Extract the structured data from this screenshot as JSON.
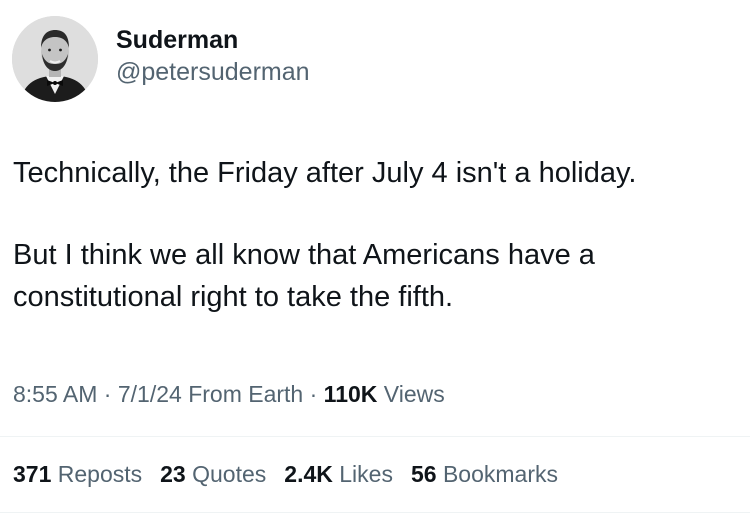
{
  "author": {
    "display_name": "Suderman",
    "handle": "@petersuderman",
    "avatar_icon": "profile-photo"
  },
  "tweet": {
    "paragraphs": [
      "Technically, the Friday after July 4 isn't a holiday.",
      "But I think we all know that Americans have a constitutional right to take the fifth."
    ]
  },
  "meta": {
    "time": "8:55 AM",
    "sep1": "·",
    "date": "7/1/24",
    "source": "From Earth",
    "sep2": "·",
    "views_count": "110K",
    "views_label": "Views"
  },
  "stats": {
    "reposts": {
      "count": "371",
      "label": "Reposts"
    },
    "quotes": {
      "count": "23",
      "label": "Quotes"
    },
    "likes": {
      "count": "2.4K",
      "label": "Likes"
    },
    "bookmarks": {
      "count": "56",
      "label": "Bookmarks"
    }
  },
  "colors": {
    "text": "#0f1419",
    "secondary": "#536471",
    "divider": "#eff3f4"
  }
}
